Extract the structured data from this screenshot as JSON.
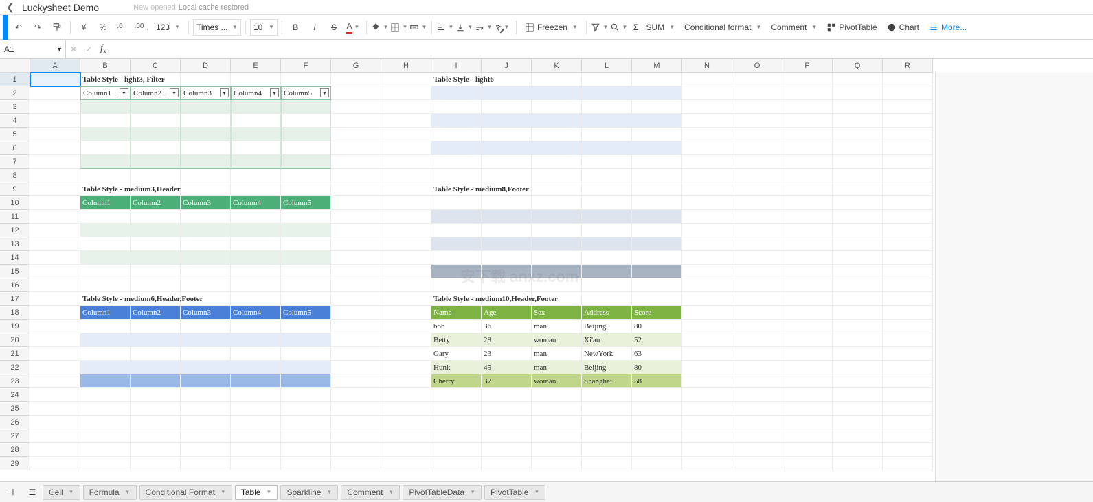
{
  "header": {
    "title": "Luckysheet Demo",
    "status1": "New opened",
    "status2": "Local cache restored"
  },
  "toolbar": {
    "currency": "¥",
    "percent": "%",
    "dec_dec": ".0",
    "inc_dec": ".00",
    "num_fmt": "123",
    "font": "Times ...",
    "fontsize": "10",
    "freeze": "Freezen",
    "sum": "SUM",
    "cond_fmt": "Conditional format",
    "comment": "Comment",
    "pivot": "PivotTable",
    "chart": "Chart",
    "more": "More..."
  },
  "namebox": {
    "ref": "A1"
  },
  "columns": [
    "A",
    "B",
    "C",
    "D",
    "E",
    "F",
    "G",
    "H",
    "I",
    "J",
    "K",
    "L",
    "M",
    "N",
    "O",
    "P",
    "Q",
    "R"
  ],
  "rows_count": 29,
  "titles": {
    "t1": "Table Style - light3, Filter",
    "t2": "Table Style - light6",
    "t3": "Table Style - medium3,Header",
    "t4": "Table Style - medium8,Footer",
    "t5": "Table Style - medium6,Header,Footer",
    "t6": "Table Style - medium10,Header,Footer"
  },
  "cols5": [
    "Column1",
    "Column2",
    "Column3",
    "Column4",
    "Column5"
  ],
  "med10": {
    "headers": [
      "Name",
      "Age",
      "Sex",
      "Address",
      "Score"
    ],
    "rows": [
      [
        "bob",
        "36",
        "man",
        "Beijing",
        "80"
      ],
      [
        "Betty",
        "28",
        "woman",
        "Xi'an",
        "52"
      ],
      [
        "Gary",
        "23",
        "man",
        "NewYork",
        "63"
      ],
      [
        "Hunk",
        "45",
        "man",
        "Beijing",
        "80"
      ],
      [
        "Cherry",
        "37",
        "woman",
        "Shanghai",
        "58"
      ]
    ]
  },
  "sheets": [
    "Cell",
    "Formula",
    "Conditional Format",
    "Table",
    "Sparkline",
    "Comment",
    "PivotTableData",
    "PivotTable"
  ],
  "active_sheet": 3,
  "watermark": "安下载 anxz.com"
}
